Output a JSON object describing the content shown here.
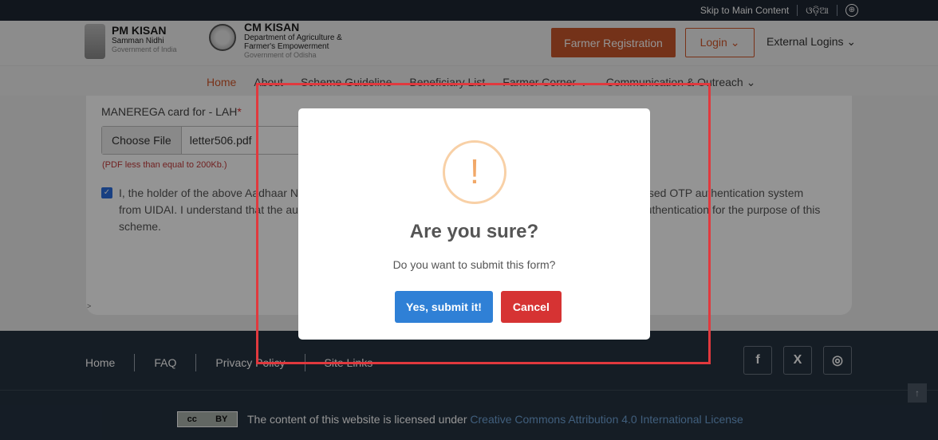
{
  "topbar": {
    "skip_link": "Skip to Main Content",
    "language": "ଓଡ଼ିଆ",
    "accessibility_glyph": "⊕"
  },
  "header": {
    "pm_title": "PM KISAN",
    "pm_sub": "Samman Nidhi",
    "pm_gov": "Government of India",
    "cm_title": "CM KISAN",
    "cm_dept_1": "Department of Agriculture &",
    "cm_dept_2": "Farmer's Empowerment",
    "cm_gov": "Government of Odisha",
    "register_label": "Farmer Registration",
    "login_label": "Login ⌄",
    "external_label": "External Logins ⌄"
  },
  "nav": {
    "items": [
      "Home",
      "About",
      "Scheme Guideline",
      "Beneficiary List",
      "Farmer Corner ⌄",
      "Communication & Outreach ⌄"
    ]
  },
  "form": {
    "field_label": "MANEREGA card for - LAH",
    "required_mark": "*",
    "choose_file": "Choose File",
    "file_name": "letter506.pdf",
    "hint": "(PDF less than equal to 200Kb.)",
    "consent_checkbox": "✓",
    "consent_text": "I, the holder of the above Aadhaar Number, hereby give my consent to authenticate myself with Aadhaar based OTP authentication system from UIDAI. I understand that the authentication will use my One Time Pin (OTP) data for Aadhaar based authentication for the purpose of this scheme.",
    "collapse_mark": ">"
  },
  "modal": {
    "icon": "!",
    "title": "Are you sure?",
    "text": "Do you want to submit this form?",
    "confirm_label": "Yes, submit it!",
    "cancel_label": "Cancel"
  },
  "footer": {
    "links": [
      "Home",
      "FAQ",
      "Privacy Policy",
      "Site Links"
    ],
    "socials": [
      "f",
      "X",
      "◎"
    ],
    "license_prefix": "The content of this website is licensed under ",
    "license_link": "Creative Commons Attribution 4.0 International License",
    "cc_badge_1": "cc",
    "cc_badge_2": "BY",
    "to_top": "↑"
  },
  "colors": {
    "accent": "#c8562b",
    "footer_bg": "#253241",
    "confirm": "#2f80d6",
    "cancel": "#d63333",
    "highlight": "#e0393e"
  }
}
